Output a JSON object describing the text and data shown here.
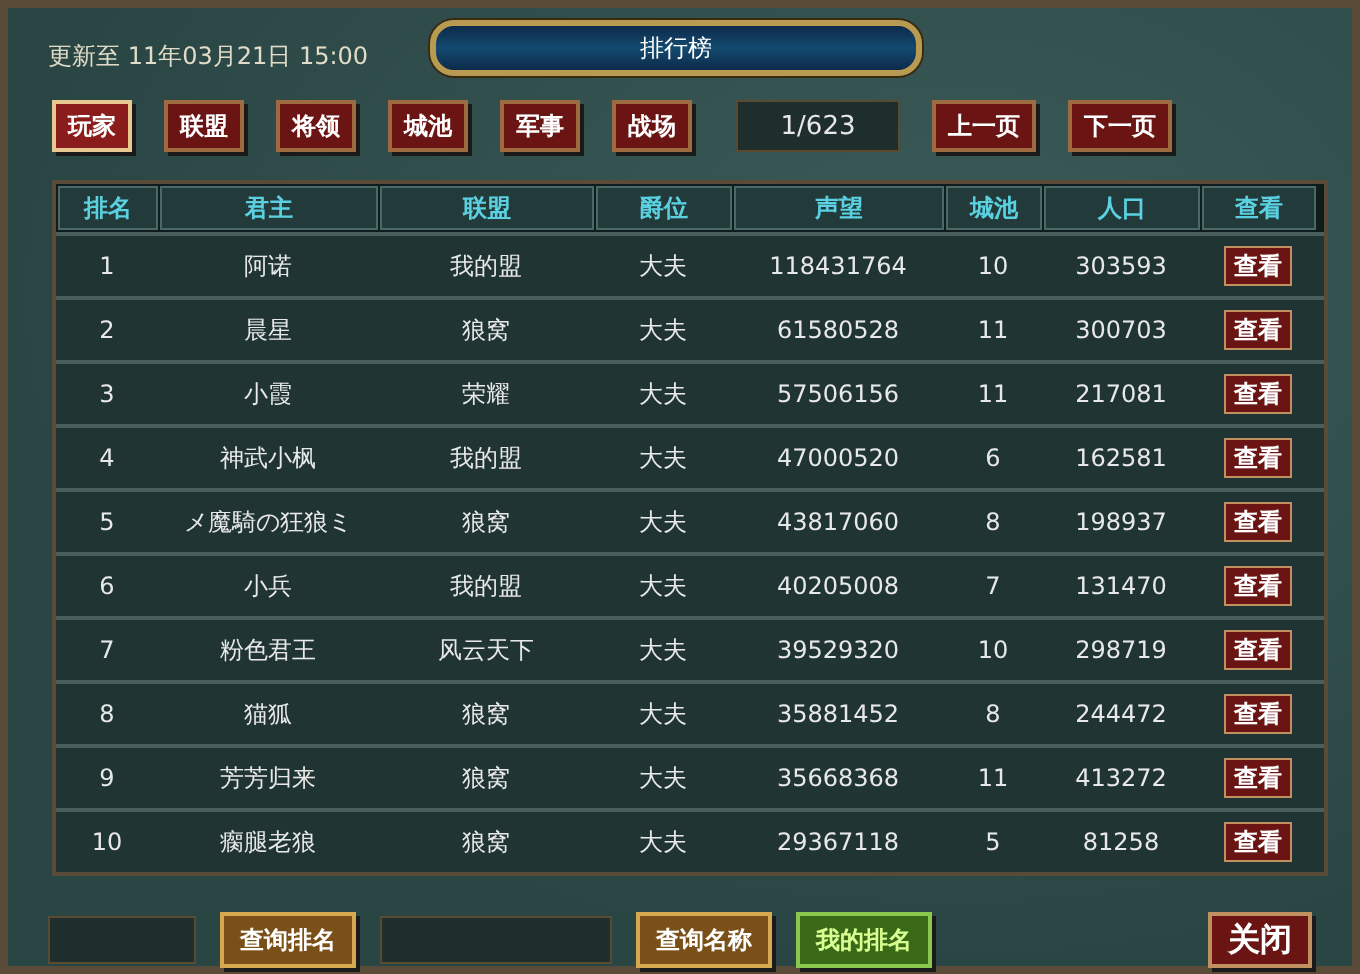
{
  "header": {
    "updated": "更新至 11年03月21日 15:00",
    "title": "排行榜"
  },
  "tabs": [
    {
      "label": "玩家",
      "selected": true
    },
    {
      "label": "联盟",
      "selected": false
    },
    {
      "label": "将领",
      "selected": false
    },
    {
      "label": "城池",
      "selected": false
    },
    {
      "label": "军事",
      "selected": false
    },
    {
      "label": "战场",
      "selected": false
    }
  ],
  "pager": {
    "page": "1/623",
    "prev": "上一页",
    "next": "下一页"
  },
  "table": {
    "columns": [
      "排名",
      "君主",
      "联盟",
      "爵位",
      "声望",
      "城池",
      "人口",
      "查看"
    ],
    "rows": [
      {
        "cells": [
          "1",
          "阿诺",
          "我的盟",
          "大夫",
          "118431764",
          "10",
          "303593"
        ],
        "action": "查看"
      },
      {
        "cells": [
          "2",
          "晨星",
          "狼窝",
          "大夫",
          "61580528",
          "11",
          "300703"
        ],
        "action": "查看"
      },
      {
        "cells": [
          "3",
          "小霞",
          "荣耀",
          "大夫",
          "57506156",
          "11",
          "217081"
        ],
        "action": "查看"
      },
      {
        "cells": [
          "4",
          "神武小枫",
          "我的盟",
          "大夫",
          "47000520",
          "6",
          "162581"
        ],
        "action": "查看"
      },
      {
        "cells": [
          "5",
          "メ魔騎の狂狼ミ",
          "狼窝",
          "大夫",
          "43817060",
          "8",
          "198937"
        ],
        "action": "查看"
      },
      {
        "cells": [
          "6",
          "小兵",
          "我的盟",
          "大夫",
          "40205008",
          "7",
          "131470"
        ],
        "action": "查看"
      },
      {
        "cells": [
          "7",
          "粉色君王",
          "风云天下",
          "大夫",
          "39529320",
          "10",
          "298719"
        ],
        "action": "查看"
      },
      {
        "cells": [
          "8",
          "猫狐",
          "狼窝",
          "大夫",
          "35881452",
          "8",
          "244472"
        ],
        "action": "查看"
      },
      {
        "cells": [
          "9",
          "芳芳归来",
          "狼窝",
          "大夫",
          "35668368",
          "11",
          "413272"
        ],
        "action": "查看"
      },
      {
        "cells": [
          "10",
          "瘸腿老狼",
          "狼窝",
          "大夫",
          "29367118",
          "5",
          "81258"
        ],
        "action": "查看"
      }
    ]
  },
  "footer": [
    {
      "kind": "field"
    },
    {
      "kind": "gold",
      "label": "查询排名"
    },
    {
      "kind": "wide-field"
    },
    {
      "kind": "gold",
      "label": "查询名称"
    },
    {
      "kind": "green",
      "label": "我的排名"
    },
    {
      "kind": "spacer"
    },
    {
      "kind": "red",
      "label": "关闭"
    }
  ]
}
